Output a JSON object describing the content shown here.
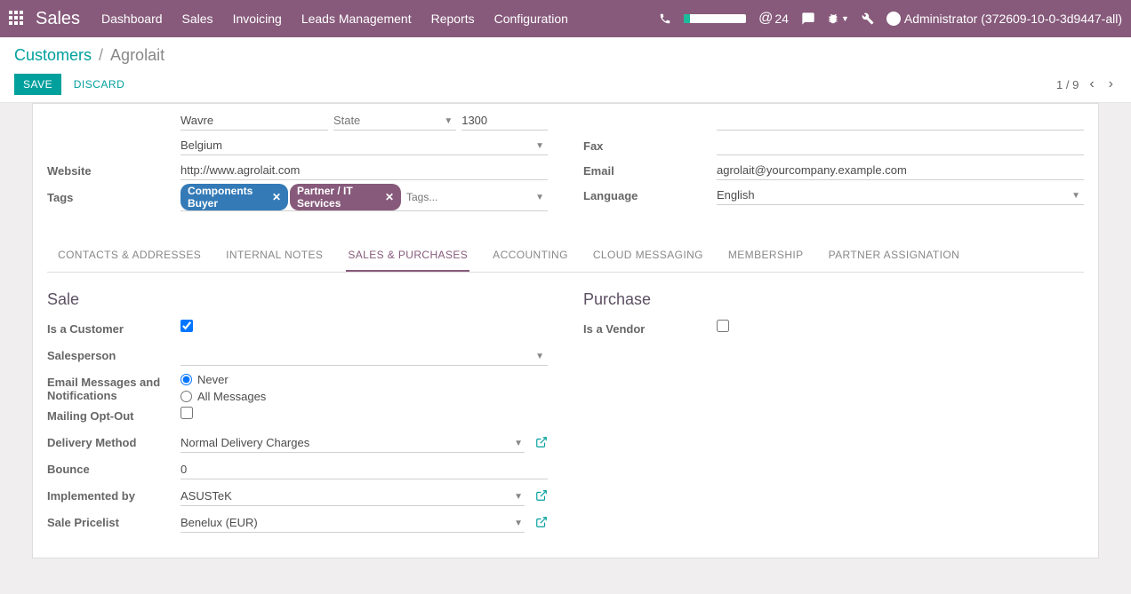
{
  "nav": {
    "brand": "Sales",
    "menu": [
      "Dashboard",
      "Sales",
      "Invoicing",
      "Leads Management",
      "Reports",
      "Configuration"
    ],
    "at_count": "24",
    "user": "Administrator (372609-10-0-3d9447-all)"
  },
  "breadcrumb": {
    "parent": "Customers",
    "current": "Agrolait"
  },
  "buttons": {
    "save": "SAVE",
    "discard": "DISCARD"
  },
  "pager": {
    "value": "1 / 9"
  },
  "form": {
    "city": "Wavre",
    "state_placeholder": "State",
    "zip": "1300",
    "country": "Belgium",
    "website_label": "Website",
    "website": "http://www.agrolait.com",
    "tags_label": "Tags",
    "tags": [
      "Components Buyer",
      "Partner / IT Services"
    ],
    "tags_placeholder": "Tags...",
    "fax_label": "Fax",
    "fax": "",
    "email_label": "Email",
    "email": "agrolait@yourcompany.example.com",
    "language_label": "Language",
    "language": "English"
  },
  "tabs": [
    "CONTACTS & ADDRESSES",
    "INTERNAL NOTES",
    "SALES & PURCHASES",
    "ACCOUNTING",
    "CLOUD MESSAGING",
    "MEMBERSHIP",
    "PARTNER ASSIGNATION"
  ],
  "active_tab": 2,
  "sale": {
    "heading": "Sale",
    "is_customer_label": "Is a Customer",
    "is_customer": true,
    "salesperson_label": "Salesperson",
    "salesperson": "",
    "notif_label": "Email Messages and Notifications",
    "notif_never": "Never",
    "notif_all": "All Messages",
    "notif_selected": "never",
    "optout_label": "Mailing Opt-Out",
    "optout": false,
    "delivery_label": "Delivery Method",
    "delivery": "Normal Delivery Charges",
    "bounce_label": "Bounce",
    "bounce": "0",
    "implemented_label": "Implemented by",
    "implemented": "ASUSTeK",
    "pricelist_label": "Sale Pricelist",
    "pricelist": "Benelux (EUR)"
  },
  "purchase": {
    "heading": "Purchase",
    "is_vendor_label": "Is a Vendor",
    "is_vendor": false
  }
}
